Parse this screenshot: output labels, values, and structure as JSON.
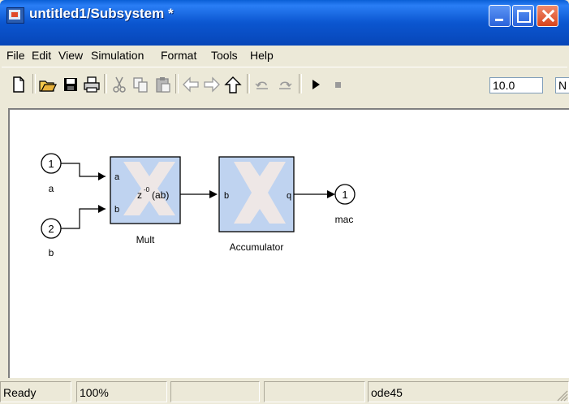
{
  "window": {
    "title": "untitled1/Subsystem *"
  },
  "menu": {
    "items": [
      {
        "label": "File"
      },
      {
        "label": "Edit"
      },
      {
        "label": "View"
      },
      {
        "label": "Simulation"
      },
      {
        "label": "Format"
      },
      {
        "label": "Tools"
      },
      {
        "label": "Help"
      }
    ]
  },
  "toolbar": {
    "icons": [
      "new-file-icon",
      "open-folder-icon",
      "save-icon",
      "print-icon",
      "cut-icon",
      "copy-icon",
      "paste-icon",
      "back-arrow-icon",
      "forward-arrow-icon",
      "up-arrow-icon",
      "undo-icon",
      "redo-icon",
      "play-icon",
      "stop-icon"
    ],
    "stop_time": "10.0",
    "solver_partial": "N"
  },
  "diagram": {
    "inport_a": {
      "number": "1",
      "name": "a"
    },
    "inport_b": {
      "number": "2",
      "name": "b"
    },
    "mult": {
      "name": "Mult",
      "port_a": "a",
      "port_b": "b",
      "expr_base": "z",
      "expr_exp": "-0",
      "expr_tail": "(ab)"
    },
    "accumulator": {
      "name": "Accumulator",
      "port_in": "b",
      "port_out": "q"
    },
    "outport": {
      "number": "1",
      "name": "mac"
    }
  },
  "status": {
    "state": "Ready",
    "zoom": "100%",
    "solver": "ode45"
  },
  "colors": {
    "block_fill": "#bfd3f0",
    "title_blue": "#0b56d0",
    "close_red": "#d9441c"
  }
}
